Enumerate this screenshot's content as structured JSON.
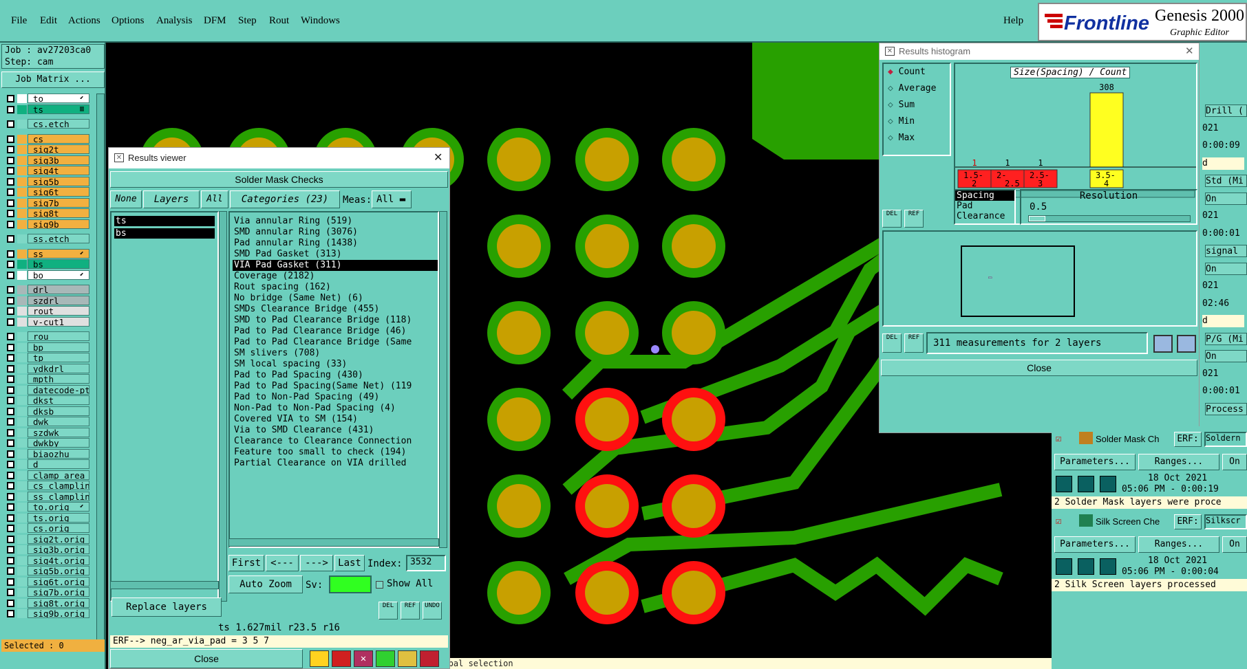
{
  "menu": {
    "items": [
      "File",
      "Edit",
      "Actions",
      "Options",
      "Analysis",
      "DFM",
      "Step",
      "Rout",
      "Windows"
    ],
    "help": "Help"
  },
  "logo": {
    "brand": "Frontline",
    "product": "Genesis 2000",
    "sub": "Graphic Editor"
  },
  "job": {
    "job": "Job : av27203ca0",
    "step": "Step: cam",
    "matrix_button": "Job Matrix ..."
  },
  "layers": [
    {
      "name": "to",
      "color": "#ffffff",
      "mark": "⬋"
    },
    {
      "name": "ts",
      "color": "#10b080",
      "mark": "▥"
    },
    {
      "name": "cs.etch",
      "color": "#7ed8c6",
      "mark": ""
    },
    {
      "name": "cs",
      "color": "#f2b040",
      "mark": ""
    },
    {
      "name": "sig2t",
      "color": "#f2b040",
      "mark": ""
    },
    {
      "name": "sig3b",
      "color": "#f2b040",
      "mark": ""
    },
    {
      "name": "sig4t",
      "color": "#f2b040",
      "mark": ""
    },
    {
      "name": "sig5b",
      "color": "#f2b040",
      "mark": ""
    },
    {
      "name": "sig6t",
      "color": "#f2b040",
      "mark": ""
    },
    {
      "name": "sig7b",
      "color": "#f2b040",
      "mark": ""
    },
    {
      "name": "sig8t",
      "color": "#f2b040",
      "mark": ""
    },
    {
      "name": "sig9b",
      "color": "#f2b040",
      "mark": ""
    },
    {
      "name": "ss.etch",
      "color": "#7ed8c6",
      "mark": ""
    },
    {
      "name": "ss",
      "color": "#f2b040",
      "mark": "⬋"
    },
    {
      "name": "bs",
      "color": "#10b080",
      "mark": ""
    },
    {
      "name": "bo",
      "color": "#ffffff",
      "mark": "⬋"
    },
    {
      "name": "drl",
      "color": "#a8b8b8",
      "mark": ""
    },
    {
      "name": "szdrl",
      "color": "#a8b8b8",
      "mark": ""
    },
    {
      "name": "rout",
      "color": "#e0e0e0",
      "mark": ""
    },
    {
      "name": "v-cut1",
      "color": "#e0e0e0",
      "mark": ""
    },
    {
      "name": "rou",
      "color": "#7ed8c6",
      "mark": ""
    },
    {
      "name": "bp",
      "color": "#7ed8c6",
      "mark": ""
    },
    {
      "name": "tp",
      "color": "#7ed8c6",
      "mark": ""
    },
    {
      "name": "ydkdrl",
      "color": "#7ed8c6",
      "mark": ""
    },
    {
      "name": "mpth",
      "color": "#7ed8c6",
      "mark": ""
    },
    {
      "name": "datecode-pt",
      "color": "#7ed8c6",
      "mark": ""
    },
    {
      "name": "dkst",
      "color": "#7ed8c6",
      "mark": ""
    },
    {
      "name": "dksb",
      "color": "#7ed8c6",
      "mark": ""
    },
    {
      "name": "dwk",
      "color": "#7ed8c6",
      "mark": ""
    },
    {
      "name": "szdwk",
      "color": "#7ed8c6",
      "mark": ""
    },
    {
      "name": "dwkby",
      "color": "#7ed8c6",
      "mark": ""
    },
    {
      "name": "biaozhu",
      "color": "#7ed8c6",
      "mark": ""
    },
    {
      "name": "d",
      "color": "#7ed8c6",
      "mark": ""
    },
    {
      "name": "clamp_area",
      "color": "#7ed8c6",
      "mark": ""
    },
    {
      "name": "cs_clampline",
      "color": "#7ed8c6",
      "mark": ""
    },
    {
      "name": "ss_clampline",
      "color": "#7ed8c6",
      "mark": ""
    },
    {
      "name": "to.orig",
      "color": "#7ed8c6",
      "mark": "⬋"
    },
    {
      "name": "ts.orig",
      "color": "#7ed8c6",
      "mark": ""
    },
    {
      "name": "cs.orig",
      "color": "#7ed8c6",
      "mark": ""
    },
    {
      "name": "sig2t.orig",
      "color": "#7ed8c6",
      "mark": ""
    },
    {
      "name": "sig3b.orig",
      "color": "#7ed8c6",
      "mark": ""
    },
    {
      "name": "sig4t.orig",
      "color": "#7ed8c6",
      "mark": ""
    },
    {
      "name": "sig5b.orig",
      "color": "#7ed8c6",
      "mark": ""
    },
    {
      "name": "sig6t.orig",
      "color": "#7ed8c6",
      "mark": ""
    },
    {
      "name": "sig7b.orig",
      "color": "#7ed8c6",
      "mark": ""
    },
    {
      "name": "sig8t.orig",
      "color": "#7ed8c6",
      "mark": ""
    },
    {
      "name": "sig9b.orig",
      "color": "#7ed8c6",
      "mark": ""
    }
  ],
  "selected": "Selected : 0",
  "rv": {
    "title": "Results viewer",
    "header": "Solder Mask Checks",
    "none": "None",
    "layers_btn": "Layers",
    "all": "All",
    "layer_list": [
      "ts",
      "bs"
    ],
    "categories_btn": "Categories (23)",
    "meas": "Meas:",
    "meas_val": "All",
    "categories": [
      "Via annular Ring (519)",
      "SMD annular Ring (3076)",
      "Pad annular Ring (1438)",
      "SMD Pad Gasket (313)",
      "VIA Pad Gasket (311)",
      "Coverage (2182)",
      "Rout spacing (162)",
      "No bridge (Same Net) (6)",
      "SMDs Clearance Bridge (455)",
      "SMD to Pad Clearance Bridge (118)",
      "Pad to Pad Clearance Bridge (46)",
      "Pad to Pad Clearance Bridge (Same",
      "SM slivers (708)",
      "SM local spacing (33)",
      "Pad to Pad Spacing (430)",
      "Pad to Pad Spacing(Same Net) (119",
      "Pad to Non-Pad Spacing (49)",
      "Non-Pad to Non-Pad Spacing (4)",
      "Covered VIA to SM (154)",
      "Via to SMD Clearance (431)",
      "Clearance to Clearance Connection",
      "Feature too small to check (194)",
      "Partial Clearance on VIA drilled"
    ],
    "first": "First",
    "prev": "<---",
    "next": "--->",
    "last": "Last",
    "index_label": "Index:",
    "index_val": "3532",
    "auto_zoom": "Auto Zoom",
    "sv": "Sv:",
    "show_all": "Show All",
    "replace": "Replace layers",
    "status": "ts 1.627mil  r23.5  r16",
    "erf": "ERF--> neg_ar_via_pad = 3 5 7",
    "close": "Close"
  },
  "hg": {
    "title": "Results histogram",
    "options": [
      "Count",
      "Average",
      "Sum",
      "Min",
      "Max"
    ],
    "chart_title": "Size(Spacing) / Count",
    "bins": [
      {
        "label": "1.5-\n2",
        "count": 1
      },
      {
        "label": "2-\n2.5",
        "count": 1
      },
      {
        "label": "2.5-\n3",
        "count": 1
      },
      {
        "label": "3.5-\n4",
        "count": 308
      }
    ],
    "peak": "308",
    "measure_list": [
      "Spacing",
      "Pad",
      "Clearance"
    ],
    "resolution_label": "Resolution",
    "resolution_val": "0.5",
    "measurements": "311 measurements for 2 layers",
    "close": "Close"
  },
  "rp": {
    "entries": [
      "Drill (",
      "021",
      "0:00:09",
      "d",
      "Std (Mi",
      "On",
      "021",
      "0:00:01",
      "signal",
      "On",
      "021",
      "02:46",
      "d",
      "P/G (Mi",
      "On",
      "021",
      "0:00:01",
      "Process"
    ],
    "sm_title": "Solder Mask Ch",
    "sm_erf": "ERF:",
    "sm_erfval": "Soldern",
    "params": "Parameters...",
    "ranges": "Ranges...",
    "on": "On",
    "sm_date": "18 Oct 2021",
    "sm_time": "05:06 PM - 0:00:19",
    "sm_msg": "2 Solder Mask layers were proce",
    "ss_title": "Silk Screen Che",
    "ss_erf": "ERF:",
    "ss_erfval": "Silkscr",
    "ss_date": "18 Oct 2021",
    "ss_time": "05:06 PM - 0:00:04",
    "ss_msg": "2 Silk Screen layers processed"
  },
  "bottom": "Global selection"
}
